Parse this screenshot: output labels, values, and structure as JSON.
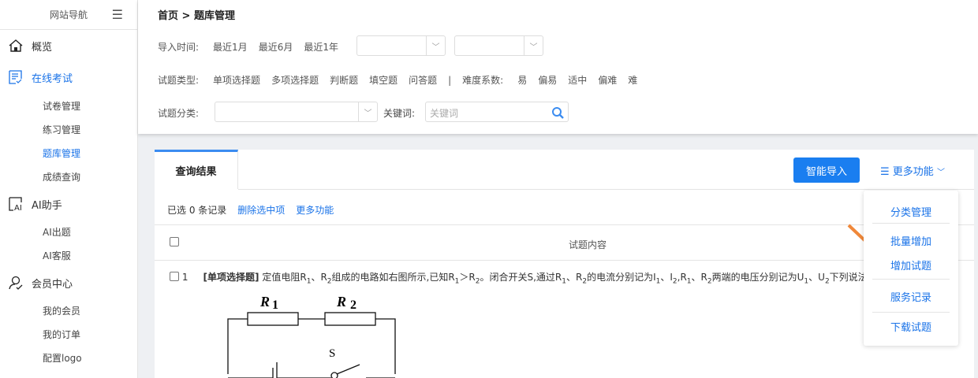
{
  "sidebar": {
    "title": "网站导航",
    "groups": [
      {
        "label": "概览",
        "icon": "home-icon"
      },
      {
        "label": "在线考试",
        "icon": "exam-icon",
        "items": [
          "试卷管理",
          "练习管理",
          "题库管理",
          "成绩查询"
        ],
        "active_item": "题库管理"
      },
      {
        "label": "AI助手",
        "icon": "ai-icon",
        "items": [
          "AI出题",
          "AI客服"
        ]
      },
      {
        "label": "会员中心",
        "icon": "user-icon",
        "items": [
          "我的会员",
          "我的订单",
          "配置logo"
        ]
      }
    ]
  },
  "breadcrumb": {
    "home": "首页",
    "sep": ">",
    "current": "题库管理"
  },
  "filters": {
    "import_time": {
      "label": "导入时间:",
      "options": [
        "最近1月",
        "最近6月",
        "最近1年"
      ]
    },
    "type": {
      "label": "试题类型:",
      "options": [
        "单项选择题",
        "多项选择题",
        "判断题",
        "填空题",
        "问答题"
      ],
      "sep": "|"
    },
    "difficulty": {
      "label": "难度系数:",
      "options": [
        "易",
        "偏易",
        "适中",
        "偏难",
        "难"
      ]
    },
    "category": {
      "label": "试题分类:"
    },
    "keyword": {
      "label": "关键词:",
      "placeholder": "关键词"
    }
  },
  "results": {
    "tab": "查询结果",
    "smart_import": "智能导入",
    "more": "更多功能",
    "selected": "已选 0 条记录",
    "delete_selected": "删除选中项",
    "more_link": "更多功能",
    "column": "试题内容",
    "rows": [
      {
        "index": "1",
        "type": "[单项选择题]",
        "text_parts": [
          "定值电阻R",
          "1",
          "、R",
          "2",
          "组成的电路如右图所示,已知R",
          "1",
          "＞R",
          "2",
          "。闭合开关S,通过R",
          "1",
          "、R",
          "2",
          "的电流分别记为I",
          "1",
          "、I",
          "2",
          ",R",
          "1",
          "、R",
          "2",
          "两端的电压分别记为U",
          "1",
          "、U",
          "2",
          "下列说法正"
        ]
      }
    ],
    "circuit_labels": {
      "r1": "R",
      "r1_sub": "1",
      "r2": "R",
      "r2_sub": "2",
      "s": "S"
    }
  },
  "menu": {
    "items": [
      "分类管理",
      "批量增加",
      "增加试题",
      "服务记录",
      "下载试题"
    ]
  },
  "colors": {
    "accent": "#1a73e8",
    "button": "#1a7ef0",
    "arrow": "#f0883a"
  }
}
